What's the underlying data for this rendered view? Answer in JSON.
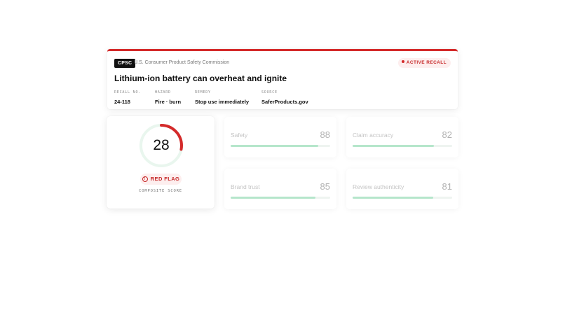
{
  "recall": {
    "agency_badge": "CPSC",
    "agency_name": "U.S. Consumer Product Safety Commission",
    "status": "ACTIVE RECALL",
    "title": "Lithium-ion battery can overheat and ignite",
    "fields": [
      {
        "label": "RECALL NO.",
        "value": "24-118"
      },
      {
        "label": "HAZARD",
        "value": "Fire · burn"
      },
      {
        "label": "REMEDY",
        "value": "Stop use immediately"
      },
      {
        "label": "SOURCE",
        "value": "SaferProducts.gov"
      }
    ]
  },
  "score": {
    "value": "28",
    "fraction": 0.28,
    "flag": "RED FLAG",
    "caption": "COMPOSITE SCORE"
  },
  "metrics": [
    {
      "label": "Safety",
      "value": "88",
      "fraction": 0.88
    },
    {
      "label": "Claim accuracy",
      "value": "82",
      "fraction": 0.82
    },
    {
      "label": "Brand trust",
      "value": "85",
      "fraction": 0.85
    },
    {
      "label": "Review authenticity",
      "value": "81",
      "fraction": 0.81
    }
  ],
  "colors": {
    "accent_red": "#d42a2a",
    "track_green": "#e9f6ee",
    "bar_green": "#b5e6cb"
  }
}
